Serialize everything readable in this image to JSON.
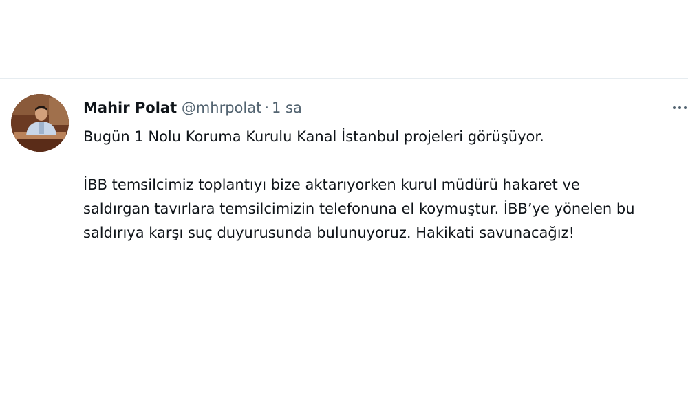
{
  "tweet": {
    "author_name": "Mahir Polat",
    "handle": "@mhrpolat",
    "separator": "·",
    "timestamp": "1 sa",
    "avatar_icon": "profile-photo",
    "more_icon": "more-horizontal-icon",
    "text_lines": [
      "Bugün 1 Nolu Koruma Kurulu Kanal İstanbul projeleri görüşüyor.",
      "İBB temsilcimiz toplantıyı bize aktarıyorken kurul müdürü hakaret ve",
      "saldırgan tavırlara temsilcimizin telefonuna el koymuştur. İBB’ye yönelen bu",
      "saldırıya karşı suç duyurusunda bulunuyoruz. Hakikati savunacağız!"
    ]
  }
}
